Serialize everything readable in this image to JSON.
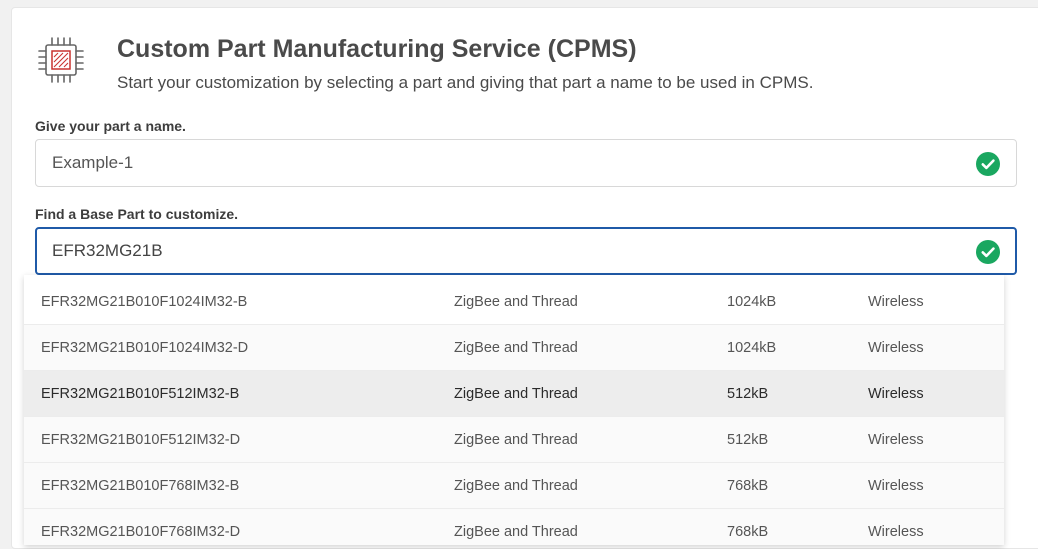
{
  "header": {
    "title": "Custom Part Manufacturing Service (CPMS)",
    "subtitle": "Start your customization by selecting a part and giving that part a name to be used in CPMS.",
    "icon": "chip-icon"
  },
  "name_field": {
    "label": "Give your part a name.",
    "value": "Example-1",
    "status_icon": "check-circle-icon"
  },
  "base_part_field": {
    "label": "Find a Base Part to customize.",
    "value": "EFR32MG21B",
    "status_icon": "check-circle-icon"
  },
  "results": [
    {
      "part": "EFR32MG21B010F1024IM32-B",
      "protocol": "ZigBee and Thread",
      "memory": "1024kB",
      "category": "Wireless"
    },
    {
      "part": "EFR32MG21B010F1024IM32-D",
      "protocol": "ZigBee and Thread",
      "memory": "1024kB",
      "category": "Wireless"
    },
    {
      "part": "EFR32MG21B010F512IM32-B",
      "protocol": "ZigBee and Thread",
      "memory": "512kB",
      "category": "Wireless"
    },
    {
      "part": "EFR32MG21B010F512IM32-D",
      "protocol": "ZigBee and Thread",
      "memory": "512kB",
      "category": "Wireless"
    },
    {
      "part": "EFR32MG21B010F768IM32-B",
      "protocol": "ZigBee and Thread",
      "memory": "768kB",
      "category": "Wireless"
    },
    {
      "part": "EFR32MG21B010F768IM32-D",
      "protocol": "ZigBee and Thread",
      "memory": "768kB",
      "category": "Wireless"
    }
  ],
  "colors": {
    "accent_border": "#1f5aa8",
    "success": "#1aa760",
    "icon_red": "#c8322f",
    "title_text": "#4a4a4a",
    "highlight_row": "#ededed"
  }
}
